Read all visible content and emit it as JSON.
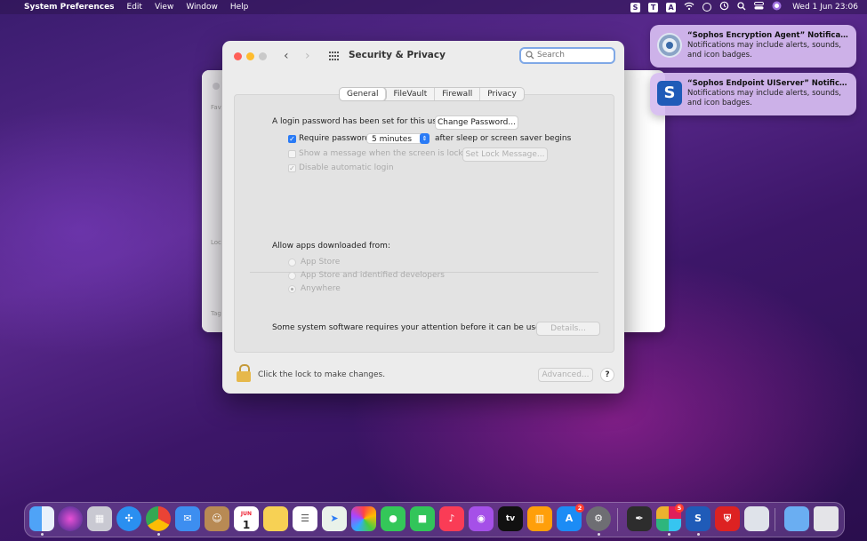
{
  "menubar": {
    "apple": "",
    "app_name": "System Preferences",
    "menus": [
      "Edit",
      "View",
      "Window",
      "Help"
    ],
    "clock": "Wed 1 Jun  23:06"
  },
  "window": {
    "title": "Security & Privacy",
    "search_placeholder": "Search",
    "tabs": [
      "General",
      "FileVault",
      "Firewall",
      "Privacy"
    ],
    "active_tab": "General",
    "general": {
      "login_password_text": "A login password has been set for this user",
      "change_password_label": "Change Password...",
      "require_password_label": "Require password",
      "require_password_checked": true,
      "require_password_interval": "5 minutes",
      "after_sleep_text": "after sleep or screen saver begins",
      "show_message_label": "Show a message when the screen is locked",
      "set_lock_message_label": "Set Lock Message...",
      "disable_auto_login_label": "Disable automatic login",
      "allow_apps_heading": "Allow apps downloaded from:",
      "allow_options": [
        "App Store",
        "App Store and identified developers",
        "Anywhere"
      ],
      "allow_selected": "Anywhere",
      "system_software_text": "Some system software requires your attention before it can be used.",
      "details_label": "Details..."
    },
    "footer": {
      "lock_text": "Click the lock to make changes.",
      "advanced_label": "Advanced...",
      "help_label": "?"
    }
  },
  "notifications": [
    {
      "title": "“Sophos Encryption Agent” Notifications",
      "body": "Notifications may include alerts, sounds, and icon badges."
    },
    {
      "title": "“Sophos Endpoint UIServer” Notificatio...",
      "body": "Notifications may include alerts, sounds, and icon badges."
    }
  ],
  "dock": {
    "calendar_month": "JUN",
    "calendar_day": "1",
    "app_store_badge": "2",
    "slack_badge": "5"
  },
  "colors": {
    "accent": "#2a7bf6",
    "close": "#ff5f57",
    "minimize": "#febc2e",
    "notification_bg": "#d6bcf0"
  }
}
